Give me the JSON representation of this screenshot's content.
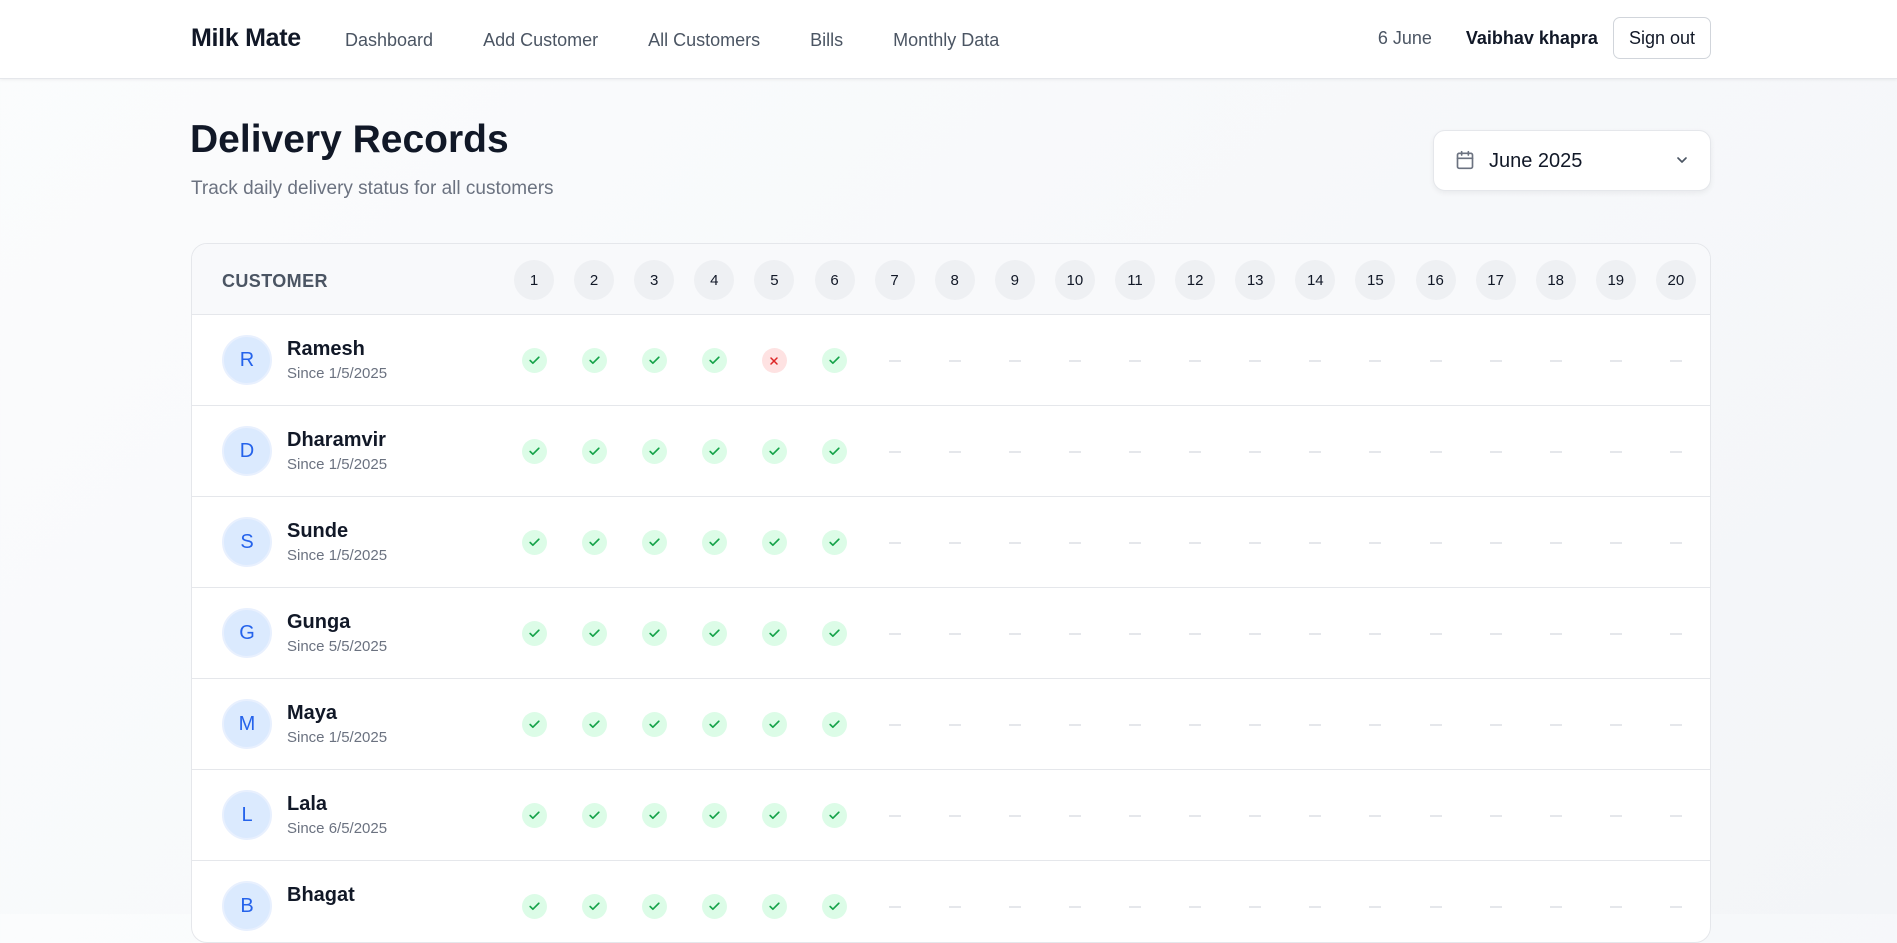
{
  "nav": {
    "brand": "Milk Mate",
    "links": [
      "Dashboard",
      "Add Customer",
      "All Customers",
      "Bills",
      "Monthly Data"
    ],
    "date": "6 June",
    "user": "Vaibhav khapra",
    "signout": "Sign out"
  },
  "header": {
    "title": "Delivery Records",
    "subtitle": "Track daily delivery status for all customers",
    "month": "June 2025"
  },
  "table": {
    "customer_header": "CUSTOMER",
    "days": [
      "1",
      "2",
      "3",
      "4",
      "5",
      "6",
      "7",
      "8",
      "9",
      "10",
      "11",
      "12",
      "13",
      "14",
      "15",
      "16",
      "17",
      "18",
      "19",
      "20"
    ],
    "rows": [
      {
        "initial": "R",
        "name": "Ramesh",
        "since": "Since 1/5/2025",
        "status": [
          "ok",
          "ok",
          "ok",
          "ok",
          "no",
          "ok",
          "none",
          "none",
          "none",
          "none",
          "none",
          "none",
          "none",
          "none",
          "none",
          "none",
          "none",
          "none",
          "none",
          "none"
        ]
      },
      {
        "initial": "D",
        "name": "Dharamvir",
        "since": "Since 1/5/2025",
        "status": [
          "ok",
          "ok",
          "ok",
          "ok",
          "ok",
          "ok",
          "none",
          "none",
          "none",
          "none",
          "none",
          "none",
          "none",
          "none",
          "none",
          "none",
          "none",
          "none",
          "none",
          "none"
        ]
      },
      {
        "initial": "S",
        "name": "Sunde",
        "since": "Since 1/5/2025",
        "status": [
          "ok",
          "ok",
          "ok",
          "ok",
          "ok",
          "ok",
          "none",
          "none",
          "none",
          "none",
          "none",
          "none",
          "none",
          "none",
          "none",
          "none",
          "none",
          "none",
          "none",
          "none"
        ]
      },
      {
        "initial": "G",
        "name": "Gunga",
        "since": "Since 5/5/2025",
        "status": [
          "ok",
          "ok",
          "ok",
          "ok",
          "ok",
          "ok",
          "none",
          "none",
          "none",
          "none",
          "none",
          "none",
          "none",
          "none",
          "none",
          "none",
          "none",
          "none",
          "none",
          "none"
        ]
      },
      {
        "initial": "M",
        "name": "Maya",
        "since": "Since 1/5/2025",
        "status": [
          "ok",
          "ok",
          "ok",
          "ok",
          "ok",
          "ok",
          "none",
          "none",
          "none",
          "none",
          "none",
          "none",
          "none",
          "none",
          "none",
          "none",
          "none",
          "none",
          "none",
          "none"
        ]
      },
      {
        "initial": "L",
        "name": "Lala",
        "since": "Since 6/5/2025",
        "status": [
          "ok",
          "ok",
          "ok",
          "ok",
          "ok",
          "ok",
          "none",
          "none",
          "none",
          "none",
          "none",
          "none",
          "none",
          "none",
          "none",
          "none",
          "none",
          "none",
          "none",
          "none"
        ]
      },
      {
        "initial": "B",
        "name": "Bhagat",
        "since": "",
        "status": [
          "ok",
          "ok",
          "ok",
          "ok",
          "ok",
          "ok",
          "none",
          "none",
          "none",
          "none",
          "none",
          "none",
          "none",
          "none",
          "none",
          "none",
          "none",
          "none",
          "none",
          "none"
        ]
      }
    ]
  },
  "colors": {
    "ok_bg": "#dcfce7",
    "ok_fg": "#16a34a",
    "no_bg": "#fee2e2",
    "no_fg": "#dc2626",
    "avatar_bg": "#dbeafe",
    "avatar_fg": "#2563eb"
  }
}
